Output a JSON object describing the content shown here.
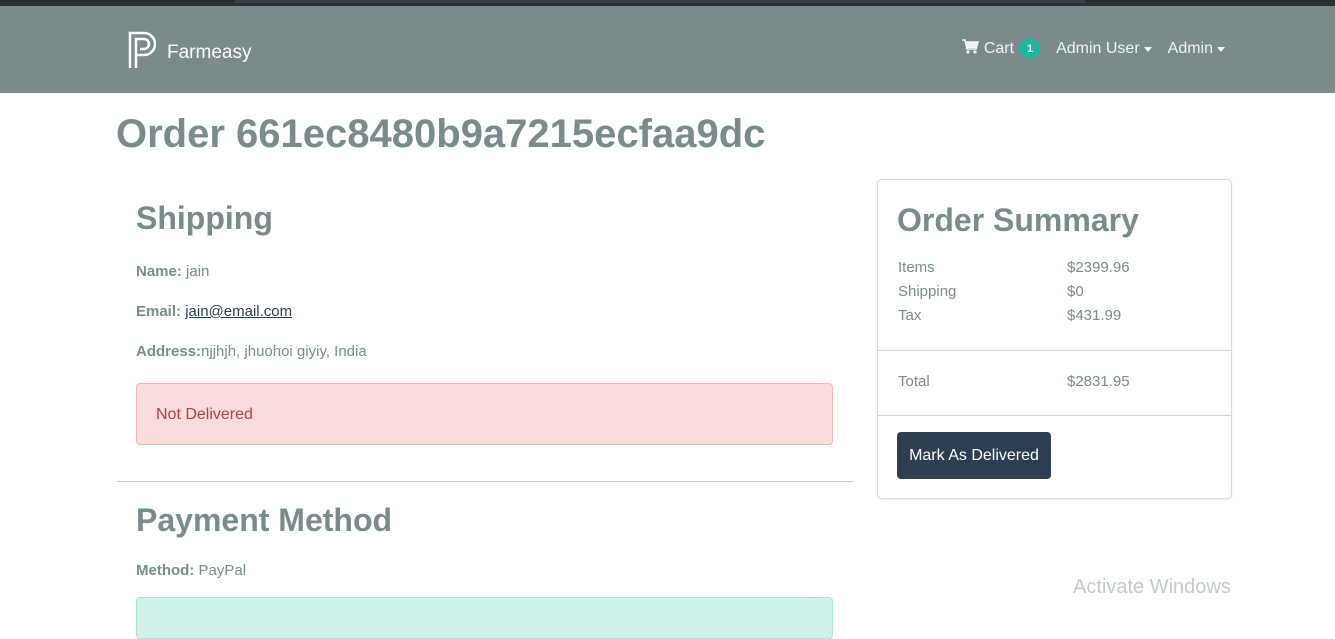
{
  "navbar": {
    "brand": "Farmeasy",
    "cart_label": "Cart",
    "cart_count": "1",
    "user_menu": "Admin User",
    "admin_menu": "Admin"
  },
  "order": {
    "title": "Order 661ec8480b9a7215ecfaa9dc"
  },
  "shipping": {
    "heading": "Shipping",
    "name_label": "Name:",
    "name_value": "jain",
    "email_label": "Email:",
    "email_value": "jain@email.com",
    "address_label": "Address:",
    "address_value": "njjhjh, jhuohoi giyiy, India",
    "status": "Not Delivered"
  },
  "payment": {
    "heading": "Payment Method",
    "method_label": "Method:",
    "method_value": "PayPal"
  },
  "summary": {
    "heading": "Order Summary",
    "items_label": "Items",
    "items_value": "$2399.96",
    "shipping_label": "Shipping",
    "shipping_value": "$0",
    "tax_label": "Tax",
    "tax_value": "$431.99",
    "total_label": "Total",
    "total_value": "$2831.95",
    "deliver_button": "Mark As Delivered"
  },
  "watermark": "Activate Windows",
  "colors": {
    "navbar": "#7b8a8b",
    "accent_badge": "#18bc9c",
    "button_dark": "#2c3e50",
    "danger_bg": "#f9dcdb",
    "danger_text": "#a94442"
  }
}
